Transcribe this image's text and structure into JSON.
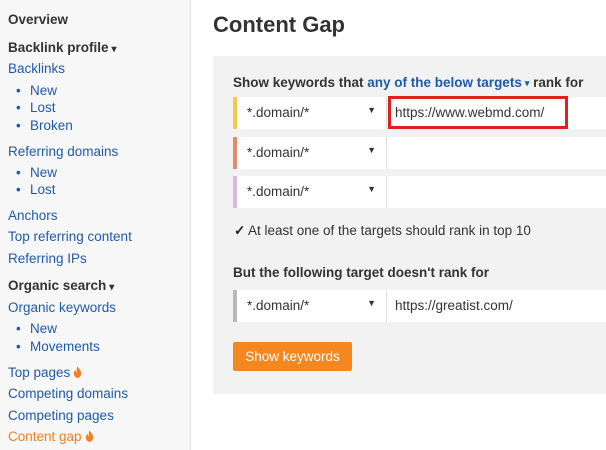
{
  "sidebar": {
    "overview": "Overview",
    "backlink_profile": {
      "label": "Backlink profile",
      "caret": "▾"
    },
    "backlinks": "Backlinks",
    "backlinks_sub": [
      "New",
      "Lost",
      "Broken"
    ],
    "referring_domains": "Referring domains",
    "referring_domains_sub": [
      "New",
      "Lost"
    ],
    "anchors": "Anchors",
    "top_referring_content": "Top referring content",
    "referring_ips": "Referring IPs",
    "organic_search": {
      "label": "Organic search",
      "caret": "▾"
    },
    "organic_keywords": "Organic keywords",
    "organic_keywords_sub": [
      "New",
      "Movements"
    ],
    "top_pages": "Top pages",
    "competing_domains": "Competing domains",
    "competing_pages": "Competing pages",
    "content_gap": "Content gap",
    "bullet": "•"
  },
  "main": {
    "title": "Content Gap",
    "targets_heading": {
      "prefix": "Show keywords that",
      "link": "any of the below targets",
      "caret": "▾",
      "suffix": "rank for"
    },
    "target_rows": [
      {
        "mode": "*.domain/*",
        "url": "https://www.webmd.com/",
        "stripe_color": "#f2c94c"
      },
      {
        "mode": "*.domain/*",
        "url": "",
        "stripe_color": "#e8876a"
      },
      {
        "mode": "*.domain/*",
        "url": "",
        "stripe_color": "#d5b8e3"
      }
    ],
    "select_arrow": "▼",
    "top10_check": {
      "mark": "✓",
      "label": "At least one of the targets should rank in top 10"
    },
    "exclude_heading": "But the following target doesn't rank for",
    "exclude_row": {
      "mode": "*.domain/*",
      "url": "https://greatist.com/",
      "stripe_color": "#b8b8b8"
    },
    "show_button": "Show keywords"
  },
  "colors": {
    "link": "#1f5aa8",
    "active": "#f47e20",
    "button": "#f5871f",
    "highlight": "#e0201b"
  }
}
